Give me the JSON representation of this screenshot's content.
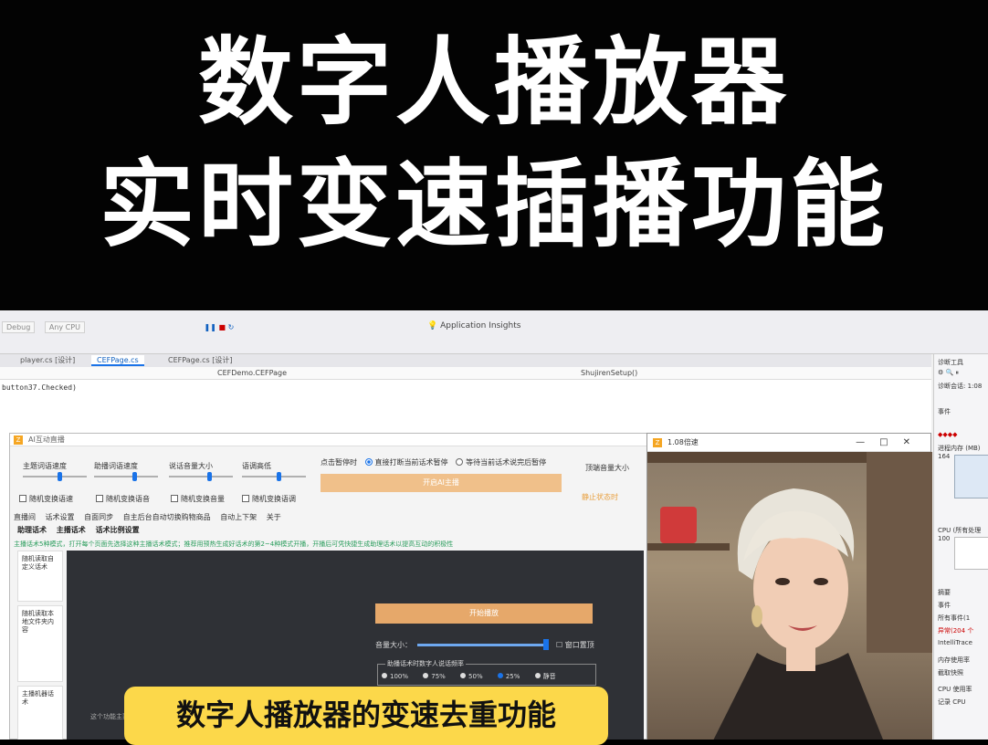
{
  "banner": {
    "title_line1": "数字人播放器",
    "title_line2": "实时变速插播功能"
  },
  "ide": {
    "toolbar_row1": [
      "Debug",
      "Any CPU"
    ],
    "toolbar_row2": [
      "",
      ""
    ],
    "app_insights": "Application Insights",
    "tabs": [
      "player.cs [设计]",
      "CEFPage.cs",
      "CEFPage.cs [设计]"
    ],
    "nav_left": "CEFDemo.CEFPage",
    "nav_right": "ShujirenSetup()",
    "code_line": "button37.Checked)"
  },
  "app": {
    "title": "AI互动直播",
    "sliders": [
      {
        "label": "主题词语速度",
        "value": 0.55
      },
      {
        "label": "助播词语速度",
        "value": 0.6
      },
      {
        "label": "说话音量大小",
        "value": 0.6
      },
      {
        "label": "语调高低",
        "value": 0.55
      }
    ],
    "checks": [
      "随机变换语速",
      "随机变换语音",
      "随机变换音量",
      "随机变换语调"
    ],
    "pause_label": "点击暂停时",
    "pause_options": [
      "直接打断当前话术暂停",
      "等待当前话术说完后暂停"
    ],
    "start_ai_button": "开启AI主播",
    "right_label": "顶端音量大小",
    "orange_text": "静止状态时",
    "subtabs1": [
      "直播间",
      "话术设置",
      "自面同步",
      "自主后台自动切换购物商品",
      "自动上下架",
      "关于"
    ],
    "subtabs2": [
      "助理话术",
      "主播话术",
      "话术比例设置"
    ],
    "notice": "主播话术5种模式，打开每个页面先选择这种主播话术模式；推荐用预热生成好话术的第2~4种模式开播，开播后可凭快捷生成助理话术以提高互动的积极性",
    "left_items": [
      "随机读取自定义话术",
      "随机读取本地文件夹内容",
      "主播机器话术"
    ],
    "start_broadcast_button": "开始播放",
    "volume_label": "音量大小：",
    "volume_value": 0.95,
    "window_top_label": "窗口置顶",
    "frequency_title": "助播话术时数字人说话频率",
    "frequency_options": [
      "100%",
      "75%",
      "50%",
      "25%",
      "静音"
    ],
    "frequency_selected": 3,
    "gray_text": "这个功能主要..."
  },
  "video_window": {
    "title": "1.08倍速",
    "controls": [
      "—",
      "□",
      "✕"
    ]
  },
  "diagnostics": {
    "title": "诊断工具",
    "session": "诊断会话: 1:08",
    "events": "事件",
    "memory": "进程内存 (MB)",
    "memory_value": "164",
    "cpu": "CPU (所有处理",
    "cpu_value": "100",
    "tabs": "摘要",
    "events2": "事件",
    "all_events": "所有事件(1",
    "exceptions": "异常(204 个",
    "intellitrace": "IntelliTrace",
    "memory_usage": "内存使用率",
    "snapshot": "截取快照",
    "cpu_usage": "CPU 使用率",
    "record": "记录 CPU"
  },
  "caption": "数字人播放器的变速去重功能",
  "colors": {
    "caption_bg": "#fcd84a",
    "accent": "#1a73e8",
    "orange": "#f0c08a"
  }
}
